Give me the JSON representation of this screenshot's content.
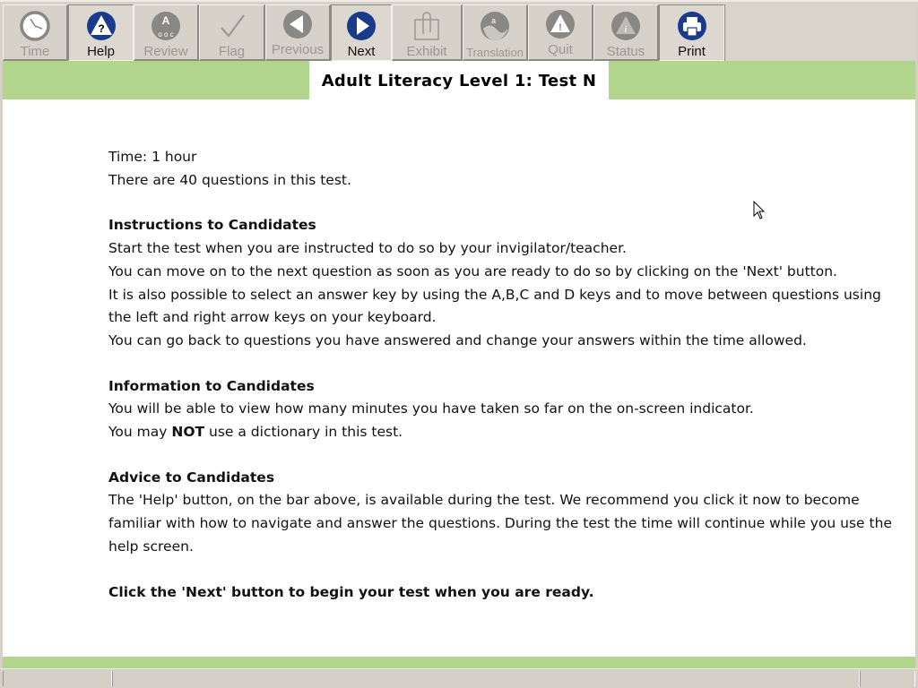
{
  "toolbar": {
    "buttons": [
      {
        "id": "time",
        "label": "Time",
        "icon": "clock-icon",
        "enabled": false
      },
      {
        "id": "help",
        "label": "Help",
        "icon": "help-triangle-icon",
        "enabled": true
      },
      {
        "id": "review",
        "label": "Review",
        "icon": "review-icon",
        "enabled": false
      },
      {
        "id": "flag",
        "label": "Flag",
        "icon": "checkmark-icon",
        "enabled": false
      },
      {
        "id": "previous",
        "label": "Previous",
        "icon": "arrow-left-icon",
        "enabled": false
      },
      {
        "id": "next",
        "label": "Next",
        "icon": "arrow-right-icon",
        "enabled": true
      },
      {
        "id": "exhibit",
        "label": "Exhibit",
        "icon": "paperclip-icon",
        "enabled": false
      },
      {
        "id": "translation",
        "label": "Translation",
        "icon": "translation-icon",
        "enabled": false
      },
      {
        "id": "quit",
        "label": "Quit",
        "icon": "warning-icon",
        "enabled": false
      },
      {
        "id": "status",
        "label": "Status",
        "icon": "info-triangle-icon",
        "enabled": false
      },
      {
        "id": "print",
        "label": "Print",
        "icon": "printer-icon",
        "enabled": true
      }
    ]
  },
  "header": {
    "title": "Adult Literacy Level 1: Test N"
  },
  "content": {
    "time_line": "Time: 1 hour",
    "questions_line": "There are 40 questions in this test.",
    "instructions": {
      "heading": "Instructions to Candidates",
      "lines": [
        "Start the test when you are instructed to do so by your invigilator/teacher.",
        "You can move on to the next question as soon as you are ready to do so by clicking on the 'Next' button.",
        "It is also possible to select an answer key by using the A,B,C and D keys and to move between questions using the left and right arrow keys on your keyboard.",
        "You can go back to questions you have answered and change your answers within the time allowed."
      ]
    },
    "information": {
      "heading": "Information to Candidates",
      "line1": "You will be able to view how many minutes you have taken so far on the on-screen indicator.",
      "line2_prefix": "You may ",
      "line2_bold": "NOT",
      "line2_suffix": " use a dictionary in this test."
    },
    "advice": {
      "heading": "Advice to Candidates",
      "text": "The 'Help' button, on the bar above, is available during the test. We recommend you click it now to become familiar with how to navigate and answer the questions. During the test the time will continue while you use the help screen."
    },
    "closing": "Click the 'Next' button to begin your test when you are ready."
  },
  "colors": {
    "accent_green": "#b2d58e",
    "icon_blue": "#1a3a8c",
    "icon_disabled_gray": "#8a8884",
    "toolbar_bg": "#d6d1c9"
  }
}
